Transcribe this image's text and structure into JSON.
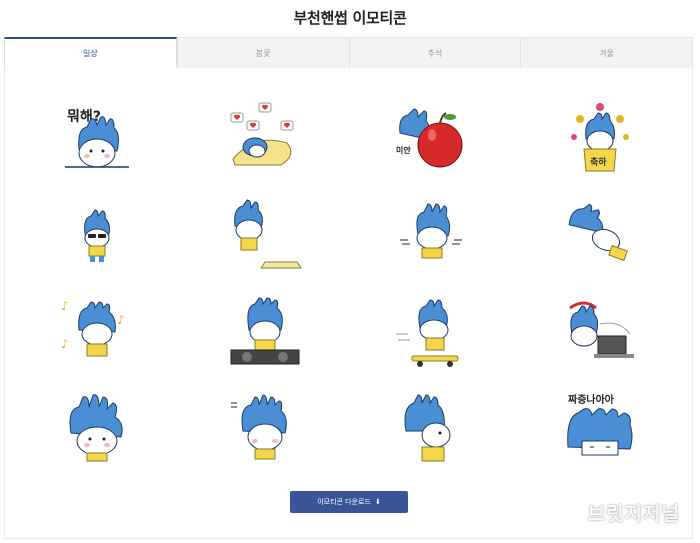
{
  "page": {
    "title": "부천핸썹 이모티콘"
  },
  "tabs": [
    {
      "label": "일상",
      "active": true
    },
    {
      "label": "봄꽃",
      "active": false
    },
    {
      "label": "추석",
      "active": false
    },
    {
      "label": "겨울",
      "active": false
    }
  ],
  "stickers": [
    {
      "name": "sticker-what-are-you-doing",
      "text": "뭐해?"
    },
    {
      "name": "sticker-hearts-blanket"
    },
    {
      "name": "sticker-sorry-apple",
      "text": "미안"
    },
    {
      "name": "sticker-congrats",
      "text": "축하"
    },
    {
      "name": "sticker-sunglasses"
    },
    {
      "name": "sticker-flat-pillow"
    },
    {
      "name": "sticker-running"
    },
    {
      "name": "sticker-rolling"
    },
    {
      "name": "sticker-music-notes"
    },
    {
      "name": "sticker-dj"
    },
    {
      "name": "sticker-skateboard"
    },
    {
      "name": "sticker-laptop"
    },
    {
      "name": "sticker-big-hand"
    },
    {
      "name": "sticker-scared"
    },
    {
      "name": "sticker-peek"
    },
    {
      "name": "sticker-annoyed",
      "text": "짜증나아아"
    }
  ],
  "download": {
    "label": "이모티콘 다운로드",
    "icon": "download-icon"
  },
  "watermark": "브릿지저널",
  "colors": {
    "accent": "#2b4e97",
    "button": "#3a5597",
    "character": "#4a8fd4",
    "shirt": "#f3d64a"
  }
}
